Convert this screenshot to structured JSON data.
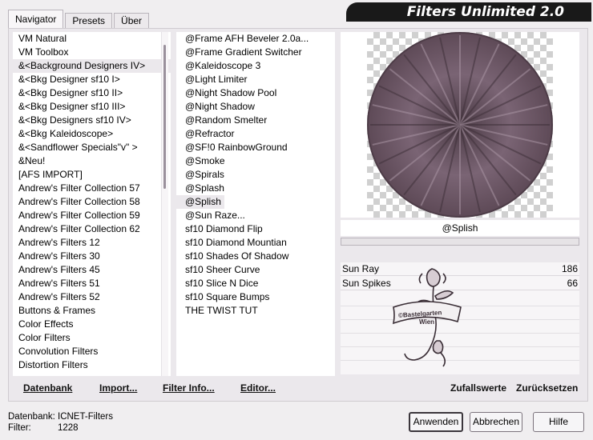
{
  "tabs": [
    "Navigator",
    "Presets",
    "Über"
  ],
  "banner_title": "Filters Unlimited 2.0",
  "categories": [
    "VM Natural",
    "VM Toolbox",
    "&<Background Designers IV>",
    "&<Bkg Designer sf10 I>",
    "&<Bkg Designer sf10 II>",
    "&<Bkg Designer sf10 III>",
    "&<Bkg Designers sf10 IV>",
    "&<Bkg Kaleidoscope>",
    "&<Sandflower Specials\"v\" >",
    "&Neu!",
    "[AFS IMPORT]",
    "Andrew's Filter Collection 57",
    "Andrew's Filter Collection 58",
    "Andrew's Filter Collection 59",
    "Andrew's Filter Collection 62",
    "Andrew's Filters 12",
    "Andrew's Filters 30",
    "Andrew's Filters 45",
    "Andrew's Filters 51",
    "Andrew's Filters 52",
    "Buttons & Frames",
    "Color Effects",
    "Color Filters",
    "Convolution Filters",
    "Distortion Filters"
  ],
  "filters": [
    "@Frame AFH Beveler 2.0a...",
    "@Frame Gradient Switcher",
    "@Kaleidoscope 3",
    "@Light Limiter",
    "@Night Shadow Pool",
    "@Night Shadow",
    "@Random Smelter",
    "@Refractor",
    "@SF!0 RainbowGround",
    "@Smoke",
    "@Spirals",
    "@Splash",
    "@Splish",
    "@Sun Raze...",
    "sf10 Diamond Flip",
    "sf10 Diamond Mountian",
    "sf10 Shades Of Shadow",
    "sf10 Sheer Curve",
    "sf10 Slice N Dice",
    "sf10 Square Bumps",
    "THE TWIST TUT"
  ],
  "selected_category_index": 2,
  "selected_filter_index": 12,
  "preview": {
    "filter_name": "@Splish",
    "disc_color": "#6e5866"
  },
  "controls": [
    {
      "label": "Sun Ray",
      "value": "186"
    },
    {
      "label": "Sun Spikes",
      "value": "66"
    }
  ],
  "watermark_text": [
    "©Bastelgarten",
    "Wien"
  ],
  "bottom_left": {
    "database": "Datenbank",
    "import": "Import...",
    "filter_info": "Filter Info...",
    "editor": "Editor..."
  },
  "bottom_right": {
    "random": "Zufallswerte",
    "reset": "Zurücksetzen"
  },
  "status": {
    "database_label": "Datenbank:",
    "database_value": "ICNET-Filters",
    "filter_label": "Filter:",
    "filter_value": "1228"
  },
  "buttons": {
    "apply": "Anwenden",
    "cancel": "Abbrechen",
    "help": "Hilfe"
  }
}
